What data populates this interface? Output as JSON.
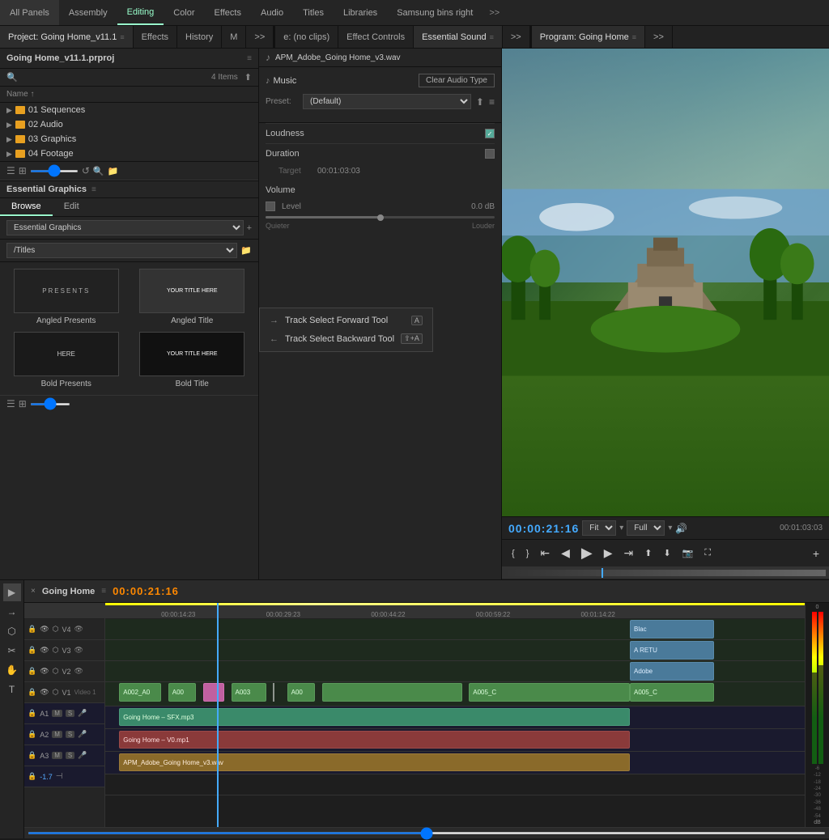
{
  "topnav": {
    "items": [
      "All Panels",
      "Assembly",
      "Editing",
      "Color",
      "Effects",
      "Audio",
      "Titles",
      "Libraries",
      "Samsung bins right"
    ],
    "active": "Editing",
    "more": ">>"
  },
  "panelTabs": {
    "left": [
      "Project: Going Home_v11.1",
      "Effects",
      "History",
      "M",
      ">>"
    ],
    "middle": [
      "e: (no clips)",
      "Effect Controls",
      "Essential Sound",
      ">>"
    ],
    "right": [
      "Program: Going Home",
      ">>"
    ]
  },
  "project": {
    "title": "Going Home_v11.1.prproj",
    "itemCount": "4 Items",
    "folders": [
      {
        "label": "01 Sequences"
      },
      {
        "label": "02 Audio"
      },
      {
        "label": "03 Graphics"
      },
      {
        "label": "04 Footage"
      }
    ]
  },
  "essentialGraphics": {
    "title": "Essential Graphics",
    "tabs": [
      "Browse",
      "Edit"
    ],
    "activeTab": "Browse",
    "dropdown1": "Essential Graphics",
    "dropdown2": "/Titles",
    "items": [
      {
        "label": "Angled Presents",
        "thumbText": "PRESENTS"
      },
      {
        "label": "Angled Title",
        "thumbText": "YOUR TITLE HERE"
      },
      {
        "label": "Bold Presents",
        "thumbText": "HERE"
      },
      {
        "label": "Bold Title",
        "thumbText": "YOUR TITLE HERE"
      }
    ]
  },
  "essentialSound": {
    "filename": "APM_Adobe_Going Home_v3.wav",
    "musicLabel": "Music",
    "clearAudioType": "Clear Audio Type",
    "presetLabel": "Preset:",
    "presetValue": "(Default)",
    "loudnessLabel": "Loudness",
    "loudnessChecked": true,
    "durationLabel": "Duration",
    "durationChecked": false,
    "targetLabel": "Target",
    "targetValue": "00:01:03:03",
    "volumeLabel": "Volume",
    "levelLabel": "Level",
    "levelValue": "0.0 dB",
    "sliderQuieter": "Quieter",
    "sliderLouder": "Louder"
  },
  "programMonitor": {
    "title": "Program: Going Home",
    "timecode": "00:00:21:16",
    "duration": "00:01:03:03",
    "fitLabel": "Fit",
    "qualityLabel": "Full"
  },
  "timeline": {
    "title": "Going Home",
    "timecode": "00:00:21:16",
    "timemarks": [
      "00:00:14:23",
      "00:00:29:23",
      "00:00:44:22",
      "00:00:59:22",
      "00:01:14:22"
    ],
    "tracks": {
      "video": [
        "V4",
        "V3",
        "V2",
        "V1"
      ],
      "audio": [
        "A1",
        "A2",
        "A3"
      ]
    },
    "clips": {
      "v1Label": "Video 1",
      "a1Label": "Going Home – SFX.mp3",
      "a2Label": "Going Home – V0.mp1",
      "a3Label": "APM_Adobe_Going Home_v3.wav",
      "rightClips": [
        "Blac",
        "A RETU",
        "Adobe",
        "A005_C",
        "A005_C"
      ]
    },
    "volumeValue": "-1.7"
  },
  "contextMenu": {
    "items": [
      {
        "label": "Track Select Forward Tool",
        "shortcut": "A"
      },
      {
        "label": "Track Select Backward Tool",
        "shortcut": "⇧+A"
      }
    ]
  },
  "icons": {
    "music": "♪",
    "search": "🔍",
    "folder": "📁",
    "play": "▶",
    "pause": "⏸",
    "prev": "⏮",
    "next": "⏭",
    "stepBack": "◀",
    "stepFwd": "▶",
    "lock": "🔒",
    "eye": "👁",
    "close": "×",
    "chevronDown": "▾",
    "chevronRight": "▶",
    "settings": "≡",
    "export": "⬆"
  }
}
